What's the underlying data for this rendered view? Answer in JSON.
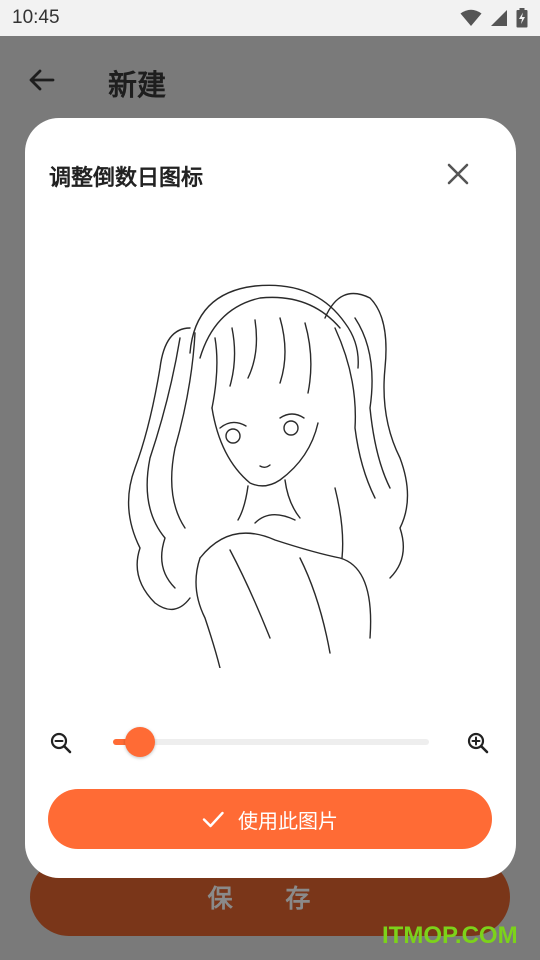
{
  "status_bar": {
    "time": "10:45"
  },
  "app_bar": {
    "title": "新建"
  },
  "background": {
    "save_label": "保 存"
  },
  "dialog": {
    "title": "调整倒数日图标",
    "zoom": {
      "value": 0.05
    },
    "use_image_label": "使用此图片"
  },
  "watermark": "ITMOP.COM",
  "colors": {
    "accent": "#ff6b35",
    "save_button_dimmed": "#7a3619",
    "scrim": "#7a7a7a",
    "watermark": "#7cd21a"
  },
  "icons": {
    "back": "arrow-left-icon",
    "close": "close-icon",
    "zoom_out": "zoom-out-icon",
    "zoom_in": "zoom-in-icon",
    "check": "check-icon"
  }
}
